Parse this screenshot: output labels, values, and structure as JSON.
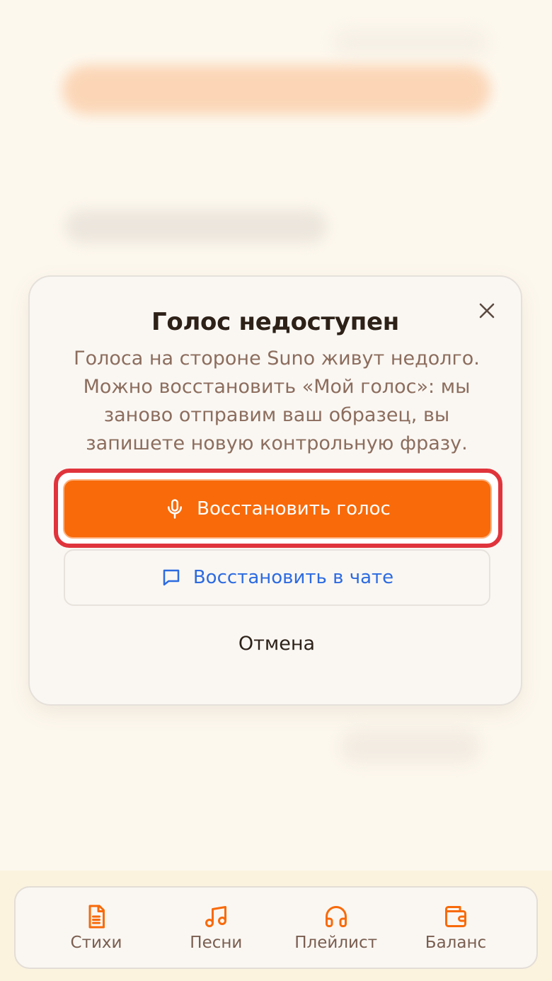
{
  "dialog": {
    "title": "Голос недоступен",
    "description": "Голоса на стороне Suno живут недолго. Можно восстановить «Мой голос»: мы заново отправим ваш образец, вы запишете новую контрольную фразу.",
    "primary_label": "Восстановить голос",
    "secondary_label": "Восстановить в чате",
    "cancel_label": "Отмена",
    "close_icon": "close-icon",
    "primary_icon": "microphone-icon",
    "secondary_icon": "chat-icon"
  },
  "nav": {
    "items": [
      {
        "label": "Стихи",
        "icon": "document-icon"
      },
      {
        "label": "Песни",
        "icon": "music-note-icon"
      },
      {
        "label": "Плейлист",
        "icon": "headphones-icon"
      },
      {
        "label": "Баланс",
        "icon": "wallet-icon"
      }
    ]
  },
  "colors": {
    "accent": "#f86a0a",
    "highlight": "#e0343c",
    "link": "#2d6be0",
    "background": "#fdf8ee"
  }
}
